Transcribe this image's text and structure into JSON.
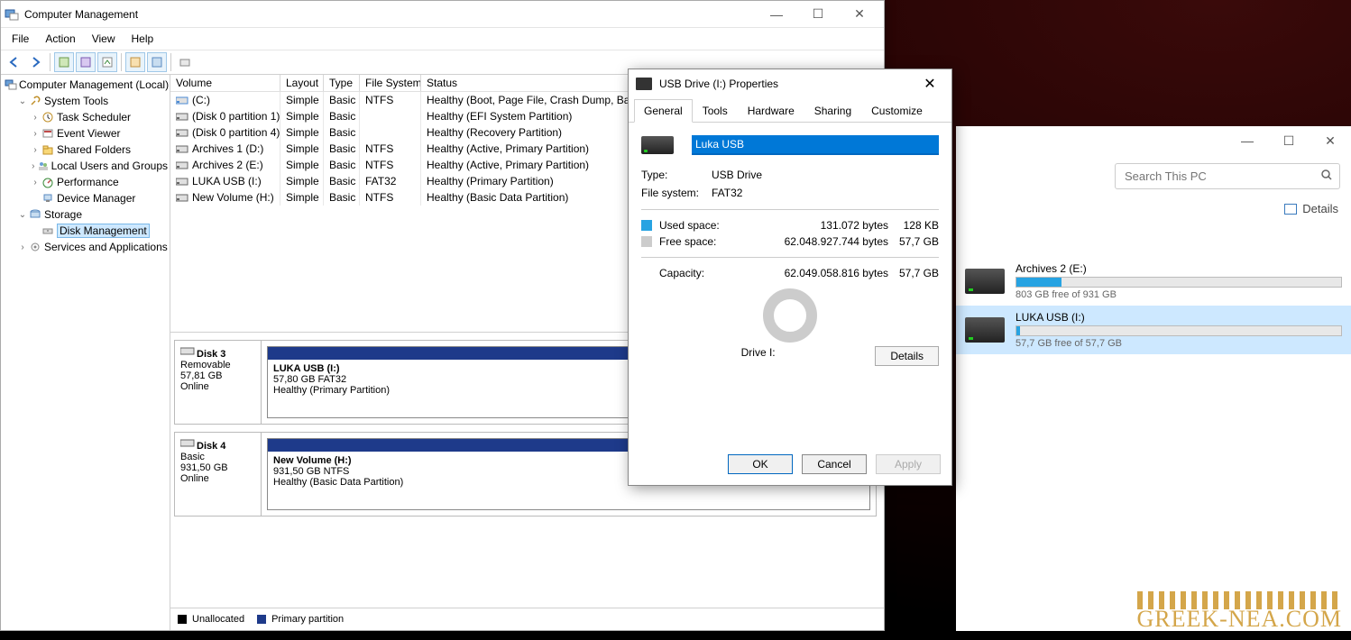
{
  "cm": {
    "title": "Computer Management",
    "menu": {
      "file": "File",
      "action": "Action",
      "view": "View",
      "help": "Help"
    },
    "tree": {
      "root": "Computer Management (Local)",
      "system_tools": "System Tools",
      "task_scheduler": "Task Scheduler",
      "event_viewer": "Event Viewer",
      "shared_folders": "Shared Folders",
      "local_users": "Local Users and Groups",
      "performance": "Performance",
      "device_manager": "Device Manager",
      "storage": "Storage",
      "disk_management": "Disk Management",
      "services": "Services and Applications"
    },
    "cols": {
      "volume": "Volume",
      "layout": "Layout",
      "type": "Type",
      "fs": "File System",
      "status": "Status"
    },
    "vols": [
      {
        "name": "(C:)",
        "layout": "Simple",
        "type": "Basic",
        "fs": "NTFS",
        "status": "Healthy (Boot, Page File, Crash Dump, Basic Data Partition)"
      },
      {
        "name": "(Disk 0 partition 1)",
        "layout": "Simple",
        "type": "Basic",
        "fs": "",
        "status": "Healthy (EFI System Partition)"
      },
      {
        "name": "(Disk 0 partition 4)",
        "layout": "Simple",
        "type": "Basic",
        "fs": "",
        "status": "Healthy (Recovery Partition)"
      },
      {
        "name": "Archives 1 (D:)",
        "layout": "Simple",
        "type": "Basic",
        "fs": "NTFS",
        "status": "Healthy (Active, Primary Partition)"
      },
      {
        "name": "Archives 2 (E:)",
        "layout": "Simple",
        "type": "Basic",
        "fs": "NTFS",
        "status": "Healthy (Active, Primary Partition)"
      },
      {
        "name": "LUKA USB (I:)",
        "layout": "Simple",
        "type": "Basic",
        "fs": "FAT32",
        "status": "Healthy (Primary Partition)"
      },
      {
        "name": "New Volume (H:)",
        "layout": "Simple",
        "type": "Basic",
        "fs": "NTFS",
        "status": "Healthy (Basic Data Partition)"
      }
    ],
    "disks": [
      {
        "name": "Disk 3",
        "kind": "Removable",
        "size": "57,81 GB",
        "state": "Online",
        "part": {
          "title": "LUKA USB  (I:)",
          "line2": "57,80 GB FAT32",
          "line3": "Healthy (Primary Partition)"
        }
      },
      {
        "name": "Disk 4",
        "kind": "Basic",
        "size": "931,50 GB",
        "state": "Online",
        "part": {
          "title": "New Volume  (H:)",
          "line2": "931,50 GB NTFS",
          "line3": "Healthy (Basic Data Partition)"
        }
      }
    ],
    "legend": {
      "unalloc": "Unallocated",
      "primary": "Primary partition"
    }
  },
  "props": {
    "title": "USB Drive (I:) Properties",
    "tabs": {
      "general": "General",
      "tools": "Tools",
      "hardware": "Hardware",
      "sharing": "Sharing",
      "customize": "Customize"
    },
    "drive_name": "Luka USB",
    "type_label": "Type:",
    "type_value": "USB Drive",
    "fs_label": "File system:",
    "fs_value": "FAT32",
    "used_label": "Used space:",
    "used_bytes": "131.072 bytes",
    "used_short": "128 KB",
    "used_color": "#27a3e2",
    "free_label": "Free space:",
    "free_bytes": "62.048.927.744 bytes",
    "free_short": "57,7 GB",
    "free_color": "#cccccc",
    "cap_label": "Capacity:",
    "cap_bytes": "62.049.058.816 bytes",
    "cap_short": "57,7 GB",
    "drive_text": "Drive I:",
    "details": "Details",
    "ok": "OK",
    "cancel": "Cancel",
    "apply": "Apply"
  },
  "explorer": {
    "search_placeholder": "Search This PC",
    "details": "Details",
    "drives": [
      {
        "name": "Archives 2 (E:)",
        "sub": "803 GB free of 931 GB",
        "fill_pct": 14
      },
      {
        "name": "LUKA USB (I:)",
        "sub": "57,7 GB free of 57,7 GB",
        "fill_pct": 1
      }
    ]
  },
  "watermark": "GREEK-NEA.COM"
}
